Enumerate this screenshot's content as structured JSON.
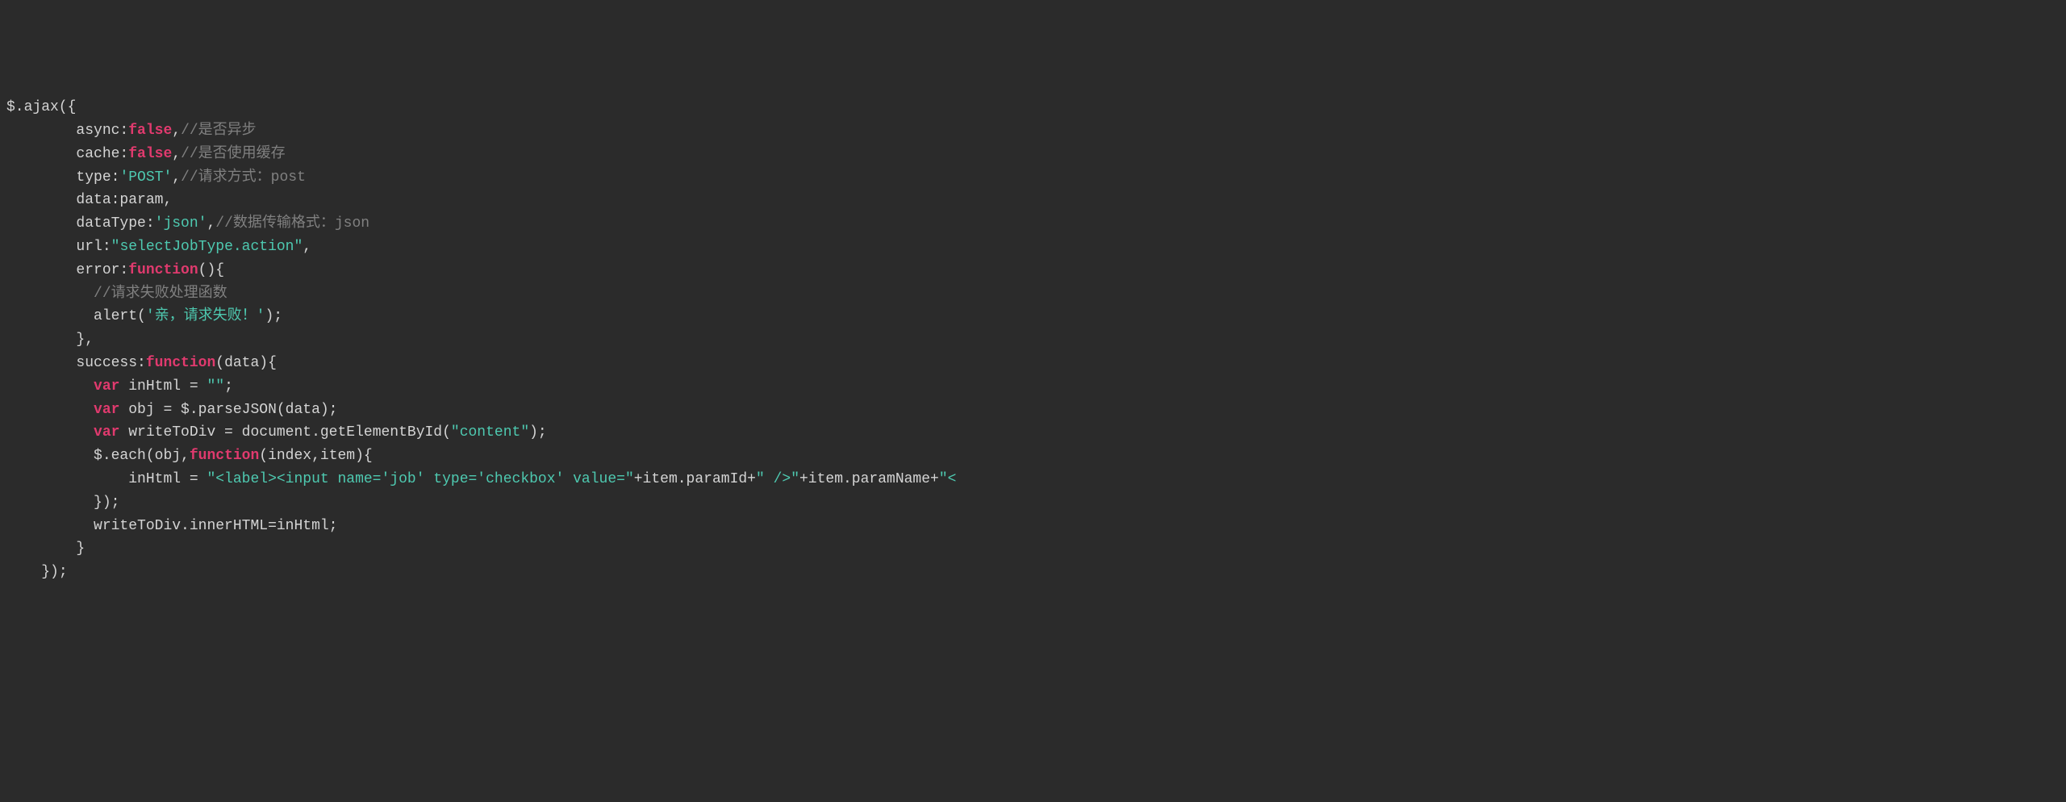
{
  "code": {
    "lines": [
      {
        "indent": 0,
        "segments": [
          {
            "text": "$.ajax({",
            "class": "default"
          }
        ]
      },
      {
        "indent": 2,
        "segments": [
          {
            "text": "async:",
            "class": "default"
          },
          {
            "text": "false",
            "class": "keyword"
          },
          {
            "text": ",",
            "class": "default"
          },
          {
            "text": "//是否异步",
            "class": "comment"
          }
        ]
      },
      {
        "indent": 2,
        "segments": [
          {
            "text": "cache:",
            "class": "default"
          },
          {
            "text": "false",
            "class": "keyword"
          },
          {
            "text": ",",
            "class": "default"
          },
          {
            "text": "//是否使用缓存",
            "class": "comment"
          }
        ]
      },
      {
        "indent": 2,
        "segments": [
          {
            "text": "type:",
            "class": "default"
          },
          {
            "text": "'POST'",
            "class": "string"
          },
          {
            "text": ",",
            "class": "default"
          },
          {
            "text": "//请求方式：post",
            "class": "comment"
          }
        ]
      },
      {
        "indent": 2,
        "segments": [
          {
            "text": "data:param,",
            "class": "default"
          }
        ]
      },
      {
        "indent": 2,
        "segments": [
          {
            "text": "dataType:",
            "class": "default"
          },
          {
            "text": "'json'",
            "class": "string"
          },
          {
            "text": ",",
            "class": "default"
          },
          {
            "text": "//数据传输格式：json",
            "class": "comment"
          }
        ]
      },
      {
        "indent": 2,
        "segments": [
          {
            "text": "url:",
            "class": "default"
          },
          {
            "text": "\"selectJobType.action\"",
            "class": "string"
          },
          {
            "text": ",",
            "class": "default"
          }
        ]
      },
      {
        "indent": 2,
        "segments": [
          {
            "text": "error:",
            "class": "default"
          },
          {
            "text": "function",
            "class": "keyword"
          },
          {
            "text": "(){",
            "class": "default"
          }
        ]
      },
      {
        "indent": 3,
        "segments": [
          {
            "text": "//请求失败处理函数",
            "class": "comment"
          }
        ]
      },
      {
        "indent": 3,
        "segments": [
          {
            "text": "alert(",
            "class": "default"
          },
          {
            "text": "'亲，请求失败！'",
            "class": "string"
          },
          {
            "text": ");",
            "class": "default"
          }
        ]
      },
      {
        "indent": 2,
        "segments": [
          {
            "text": "},",
            "class": "default"
          }
        ]
      },
      {
        "indent": 2,
        "segments": [
          {
            "text": "success:",
            "class": "default"
          },
          {
            "text": "function",
            "class": "keyword"
          },
          {
            "text": "(data){",
            "class": "default"
          }
        ]
      },
      {
        "indent": 3,
        "segments": [
          {
            "text": "var",
            "class": "keyword"
          },
          {
            "text": " inHtml = ",
            "class": "default"
          },
          {
            "text": "\"\"",
            "class": "string"
          },
          {
            "text": ";",
            "class": "default"
          }
        ]
      },
      {
        "indent": 3,
        "segments": [
          {
            "text": "var",
            "class": "keyword"
          },
          {
            "text": " obj = $.parseJSON(data);",
            "class": "default"
          }
        ]
      },
      {
        "indent": 3,
        "segments": [
          {
            "text": "var",
            "class": "keyword"
          },
          {
            "text": " writeToDiv = document.getElementById(",
            "class": "default"
          },
          {
            "text": "\"content\"",
            "class": "string"
          },
          {
            "text": ");",
            "class": "default"
          }
        ]
      },
      {
        "indent": 3,
        "segments": [
          {
            "text": "$.each(obj,",
            "class": "default"
          },
          {
            "text": "function",
            "class": "keyword"
          },
          {
            "text": "(index,item){",
            "class": "default"
          }
        ]
      },
      {
        "indent": 4,
        "segments": [
          {
            "text": "inHtml = ",
            "class": "default"
          },
          {
            "text": "\"<label><input name='job' type='checkbox' value=\"",
            "class": "string"
          },
          {
            "text": "+item.paramId+",
            "class": "default"
          },
          {
            "text": "\" />\"",
            "class": "string"
          },
          {
            "text": "+item.paramName+",
            "class": "default"
          },
          {
            "text": "\"<",
            "class": "string"
          }
        ]
      },
      {
        "indent": 3,
        "segments": [
          {
            "text": "});",
            "class": "default"
          }
        ]
      },
      {
        "indent": 3,
        "segments": [
          {
            "text": "writeToDiv.innerHTML=inHtml;",
            "class": "default"
          }
        ]
      },
      {
        "indent": 2,
        "segments": [
          {
            "text": "}",
            "class": "default"
          }
        ]
      },
      {
        "indent": 1,
        "segments": [
          {
            "text": "});",
            "class": "default"
          }
        ]
      }
    ]
  }
}
